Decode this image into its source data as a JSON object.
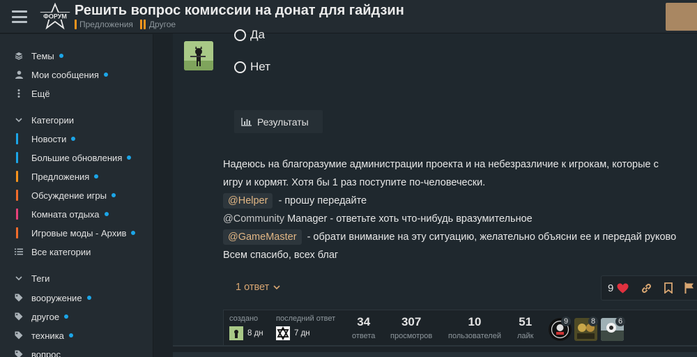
{
  "header": {
    "logo_text": "ФОРУМ",
    "title": "Решить вопрос комиссии на донат для гайдзин",
    "breadcrumbs": [
      {
        "label": "Предложения",
        "color": "#f7941d",
        "style": "single"
      },
      {
        "label": "Другое",
        "color": "#f7941d",
        "style": "double"
      }
    ]
  },
  "sidebar": {
    "top_items": [
      {
        "label": "Темы",
        "icon": "layers-icon",
        "dot": true
      },
      {
        "label": "Мои сообщения",
        "icon": "user-icon",
        "dot": true
      },
      {
        "label": "Ещё",
        "icon": "vertical-ellipsis-icon",
        "dot": false
      }
    ],
    "categories_header": "Категории",
    "categories": [
      {
        "label": "Новости",
        "color": "#1ca6e8",
        "dot": true
      },
      {
        "label": "Большие обновления",
        "color": "#1ca6e8",
        "dot": true
      },
      {
        "label": "Предложения",
        "color": "#f7941d",
        "dot": true
      },
      {
        "label": "Обсуждение игры",
        "color": "#f26c2b",
        "dot": true
      },
      {
        "label": "Комната отдыха",
        "color": "#e8417a",
        "dot": true
      },
      {
        "label": "Игровые моды - Архив",
        "color": "#f26c2b",
        "dot": true
      }
    ],
    "all_categories": "Все категории",
    "tags_header": "Теги",
    "tags": [
      {
        "label": "вооружение",
        "dot": true
      },
      {
        "label": "другое",
        "dot": true
      },
      {
        "label": "техника",
        "dot": true
      },
      {
        "label": "вопрос",
        "dot": false
      }
    ]
  },
  "post": {
    "poll_options": [
      "Да",
      "Нет"
    ],
    "results_label": "Результаты",
    "line1": "Надеюсь на благоразумие администрации проекта и на небезразличие к игрокам, которые с",
    "line2": "игру и кормят. Хотя бы 1 раз поступите по-человечески.",
    "mention1": "@Helper",
    "line3_rest": "- прошу передайте",
    "mention2": "@Community",
    "line4_rest": "Manager - ответьте хоть что-нибудь вразумительное",
    "mention3": "@GameMaster",
    "line5_rest": "- обрати внимание на эту ситуацию, желательно объясни ее и передай руково",
    "line6": "Всем спасибо, всех благ",
    "replies_label": "1 ответ",
    "likes": "9"
  },
  "topic_map": {
    "created_label": "создано",
    "created_value": "8 дн",
    "last_reply_label": "последний ответ",
    "last_reply_value": "7 дн",
    "stats": [
      {
        "num": "34",
        "label": "ответа"
      },
      {
        "num": "307",
        "label": "просмотров"
      },
      {
        "num": "10",
        "label": "пользователей"
      },
      {
        "num": "51",
        "label": "лайк"
      }
    ],
    "participants": [
      {
        "count": "9"
      },
      {
        "count": "8"
      },
      {
        "count": "6"
      }
    ]
  },
  "colors": {
    "accent": "#d8a672",
    "like": "#e0313f",
    "unread_dot": "#1ca6e8"
  }
}
